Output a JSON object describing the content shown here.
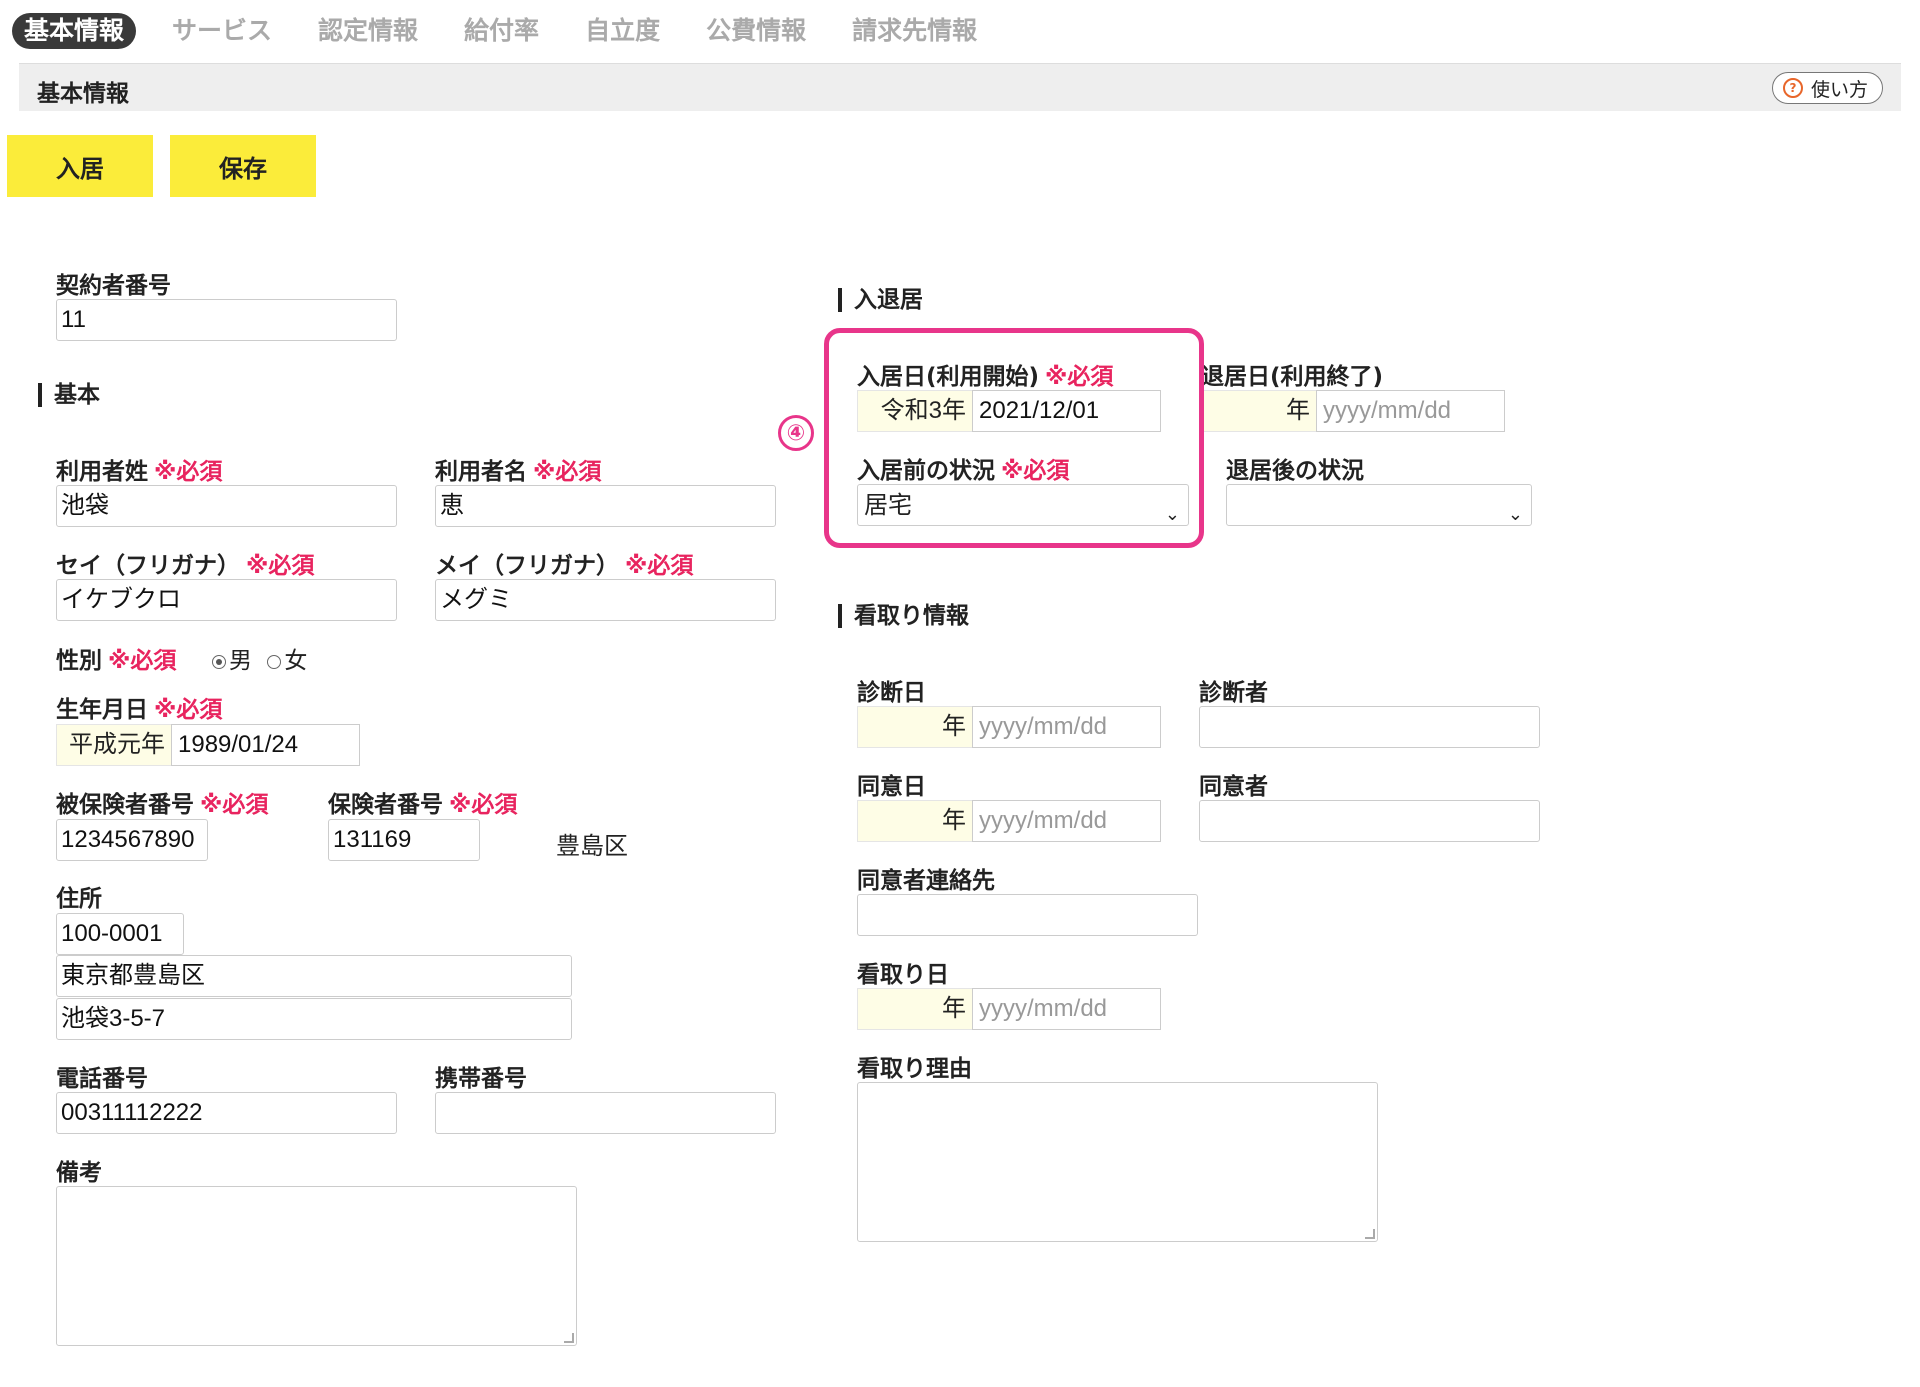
{
  "tabs": [
    "基本情報",
    "サービス",
    "認定情報",
    "給付率",
    "自立度",
    "公費情報",
    "請求先情報"
  ],
  "section": {
    "title": "基本情報",
    "help_label": "使い方",
    "help_icon": "question-icon"
  },
  "buttons": {
    "move_in": "入居",
    "save": "保存"
  },
  "required_mark": "※必須",
  "left": {
    "contract_no": {
      "label": "契約者番号",
      "value": "11"
    },
    "basic_heading": "基本",
    "last_name": {
      "label": "利用者姓",
      "value": "池袋"
    },
    "first_name": {
      "label": "利用者名",
      "value": "恵"
    },
    "last_kana": {
      "label": "セイ（フリガナ）",
      "value": "イケブクロ"
    },
    "first_kana": {
      "label": "メイ（フリガナ）",
      "value": "メグミ"
    },
    "gender": {
      "label": "性別",
      "male": "男",
      "female": "女",
      "selected": "男"
    },
    "birthday": {
      "label": "生年月日",
      "era": "平成元年",
      "value": "1989/01/24"
    },
    "insured_no": {
      "label": "被保険者番号",
      "value": "1234567890"
    },
    "insurer_no": {
      "label": "保険者番号",
      "value": "131169",
      "insurer_name": "豊島区"
    },
    "address": {
      "label": "住所",
      "postal": "100-0001",
      "line1": "東京都豊島区",
      "line2": "池袋3-5-7"
    },
    "phone": {
      "label": "電話番号",
      "value": "00311112222"
    },
    "mobile": {
      "label": "携帯番号",
      "value": ""
    },
    "notes": {
      "label": "備考",
      "value": ""
    }
  },
  "right": {
    "move_heading": "入退居",
    "move_in_date": {
      "label": "入居日(利用開始)",
      "era": "令和3年",
      "value": "2021/12/01"
    },
    "move_out_date": {
      "label": "退居日(利用終了)",
      "era": "年",
      "placeholder": "yyyy/mm/dd"
    },
    "before_status": {
      "label": "入居前の状況",
      "value": "居宅"
    },
    "after_status": {
      "label": "退居後の状況",
      "value": ""
    },
    "annotation_number": "④",
    "care_heading": "看取り情報",
    "diagnosis_date": {
      "label": "診断日",
      "era": "年",
      "placeholder": "yyyy/mm/dd"
    },
    "diagnoser": {
      "label": "診断者",
      "value": ""
    },
    "consent_date": {
      "label": "同意日",
      "era": "年",
      "placeholder": "yyyy/mm/dd"
    },
    "consenter": {
      "label": "同意者",
      "value": ""
    },
    "consenter_contact": {
      "label": "同意者連絡先",
      "value": ""
    },
    "care_date": {
      "label": "看取り日",
      "era": "年",
      "placeholder": "yyyy/mm/dd"
    },
    "care_reason": {
      "label": "看取り理由",
      "value": ""
    }
  },
  "colors": {
    "accent_yellow": "#fbec3a",
    "required_red": "#e8245f",
    "highlight_pink": "#e8358a"
  }
}
